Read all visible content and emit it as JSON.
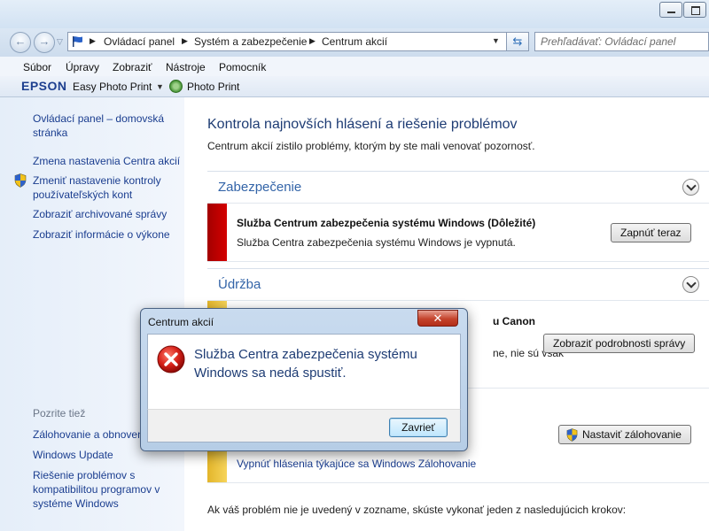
{
  "navigation": {
    "breadcrumbs": [
      "Ovládací panel",
      "Systém a zabezpečenie",
      "Centrum akcií"
    ],
    "search_placeholder": "Prehľadávať: Ovládací panel"
  },
  "menu": [
    "Súbor",
    "Úpravy",
    "Zobraziť",
    "Nástroje",
    "Pomocník"
  ],
  "toolbar": {
    "brand": "EPSON",
    "easy_photo_print": "Easy Photo Print",
    "photo_print": "Photo Print"
  },
  "sidebar": {
    "home_link": [
      "Ovládací panel – domovská",
      "stránka"
    ],
    "links": [
      {
        "lines": [
          "Zmena nastavenia Centra akcií"
        ],
        "icon": "none"
      },
      {
        "lines": [
          "Zmeniť nastavenie kontroly",
          "používateľských kont"
        ],
        "icon": "uac-shield-icon"
      },
      {
        "lines": [
          "Zobraziť archivované správy"
        ],
        "icon": "none"
      },
      {
        "lines": [
          "Zobraziť informácie o výkone"
        ],
        "icon": "none"
      }
    ],
    "see_also_heading": "Pozrite tiež",
    "see_also": [
      {
        "lines": [
          "Zálohovanie a obnovenie"
        ]
      },
      {
        "lines": [
          "Windows Update"
        ]
      },
      {
        "lines": [
          "Riešenie problémov s",
          "kompatibilitou programov v",
          "systéme Windows"
        ]
      }
    ]
  },
  "main": {
    "title": "Kontrola najnovších hlásení a riešenie problémov",
    "subtitle": "Centrum akcií zistilo problémy, ktorým by ste mali venovať pozornosť.",
    "security": {
      "heading": "Zabezpečenie",
      "alert": {
        "title": "Služba Centrum zabezpečenia systému Windows  (Dôležité)",
        "description": "Služba Centra zabezpečenia systému Windows je vypnutá.",
        "button": "Zapnúť teraz",
        "color": "#c00000"
      }
    },
    "maintenance": {
      "heading": "Údržba",
      "alert": {
        "title_visible": "u Canon",
        "description_visible": "ne, nie sú však",
        "button": "Zobraziť podrobnosti správy",
        "color": "#f3c93f"
      },
      "backup": {
        "button": "Nastaviť zálohovanie",
        "link": "Vypnúť hlásenia týkajúce sa Windows Zálohovanie",
        "color": "#f3c93f"
      }
    },
    "bottom_text": "Ak váš problém nie je uvedený v zozname, skúste vykonať jeden z nasledujúcich krokov:"
  },
  "dialog": {
    "title": "Centrum akcií",
    "message": "Služba Centra zabezpečenia systému Windows sa nedá spustiť.",
    "close_button": "Zavrieť",
    "icon": "error-icon"
  }
}
